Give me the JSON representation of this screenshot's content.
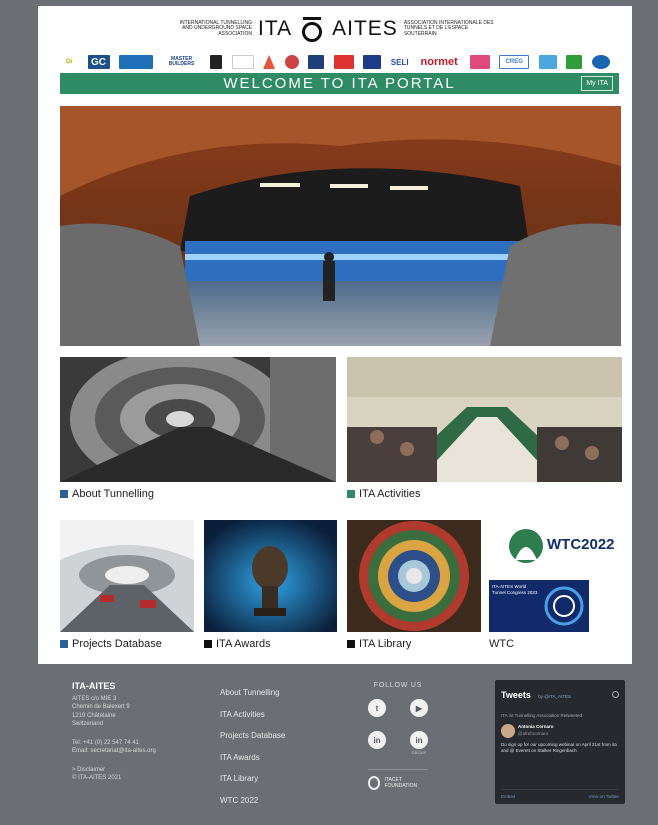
{
  "header": {
    "left_text": "INTERNATIONAL TUNNELLING AND UNDERGROUND SPACE ASSOCIATION",
    "brand_left": "ITA",
    "brand_right": "AITES",
    "right_text": "ASSOCIATION INTERNATIONALE DES TUNNELS ET DE L'ESPACE SOUTERRAIN"
  },
  "sponsors": [
    "Gi",
    "GC",
    "",
    "MASTER BUILDERS",
    "",
    "",
    "",
    "",
    "",
    "",
    "",
    "SELI",
    "normet",
    "",
    "CREG",
    "",
    "",
    ""
  ],
  "welcome": {
    "title": "WELCOME TO ITA PORTAL",
    "my_ita": "My ITA"
  },
  "tiles": {
    "about_tunnelling": "About Tunnelling",
    "ita_activities": "ITA Activities",
    "projects_database": "Projects Database",
    "ita_awards": "ITA Awards",
    "ita_library": "ITA Library",
    "wtc": "WTC",
    "wtc_logo": "WTC2022",
    "wtc_small": "ITA-AITES World Tunnel Congress 2023"
  },
  "footer": {
    "brand": "ITA-AITES",
    "address": [
      "AITES c/o MIE 3",
      "Chemin de Balexert 9",
      "1219 Châtelaine",
      "Switzerland"
    ],
    "tel": "Tel: +41 (0) 22 547 74 41",
    "email": "Email: secretariat@ita-aites.org",
    "disclaimer": "> Disclaimer",
    "copyright": "© ITA-AITES 2021",
    "links": [
      "About Tunnelling",
      "ITA Activities",
      "Projects Database",
      "ITA Awards",
      "ITA Library",
      "WTC 2022"
    ],
    "follow": "FOLLOW US",
    "linkedin_group": "GROUP",
    "itacet": "ITACET FOUNDATION"
  },
  "tweets": {
    "title": "Tweets",
    "by": "by @ITA_AITES",
    "retweet": "ITA int Tunnelling Association Retweeted",
    "author": "Antonia Cornaro",
    "handle": "@afrehcornaro",
    "text": "Do sign up for our upcoming webinar on April 21st from ita and @ Everett on Stalker Ringenbach",
    "embed": "Embed",
    "view": "View on Twitter"
  },
  "colors": {
    "brand_green": "#2e8b63",
    "about_square": "#2a5f9a",
    "activities_square": "#2e8b63",
    "footer_bg": "#6b6f73"
  }
}
